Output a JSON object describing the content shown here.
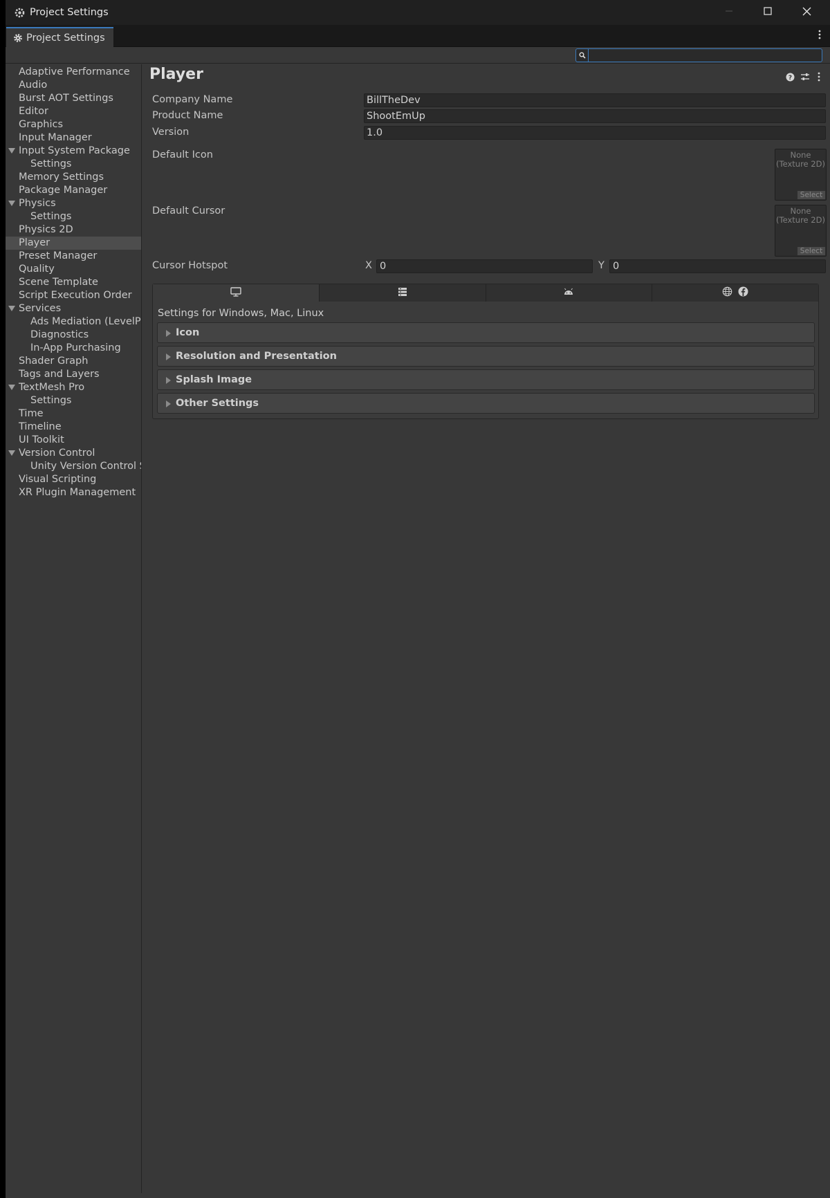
{
  "window": {
    "title": "Project Settings",
    "tab_label": "Project Settings"
  },
  "search": {
    "value": "",
    "placeholder": ""
  },
  "sidebar": {
    "items": [
      {
        "label": "Adaptive Performance",
        "indent": 1
      },
      {
        "label": "Audio",
        "indent": 1
      },
      {
        "label": "Burst AOT Settings",
        "indent": 1
      },
      {
        "label": "Editor",
        "indent": 1
      },
      {
        "label": "Graphics",
        "indent": 1
      },
      {
        "label": "Input Manager",
        "indent": 1
      },
      {
        "label": "Input System Package",
        "indent": 1,
        "expanded": true
      },
      {
        "label": "Settings",
        "indent": 2
      },
      {
        "label": "Memory Settings",
        "indent": 1
      },
      {
        "label": "Package Manager",
        "indent": 1
      },
      {
        "label": "Physics",
        "indent": 1,
        "expanded": true
      },
      {
        "label": "Settings",
        "indent": 2
      },
      {
        "label": "Physics 2D",
        "indent": 1
      },
      {
        "label": "Player",
        "indent": 1,
        "selected": true
      },
      {
        "label": "Preset Manager",
        "indent": 1
      },
      {
        "label": "Quality",
        "indent": 1
      },
      {
        "label": "Scene Template",
        "indent": 1
      },
      {
        "label": "Script Execution Order",
        "indent": 1
      },
      {
        "label": "Services",
        "indent": 1,
        "expanded": true
      },
      {
        "label": "Ads Mediation (LevelPlay)",
        "indent": 2
      },
      {
        "label": "Diagnostics",
        "indent": 2
      },
      {
        "label": "In-App Purchasing",
        "indent": 2
      },
      {
        "label": "Shader Graph",
        "indent": 1
      },
      {
        "label": "Tags and Layers",
        "indent": 1
      },
      {
        "label": "TextMesh Pro",
        "indent": 1,
        "expanded": true
      },
      {
        "label": "Settings",
        "indent": 2
      },
      {
        "label": "Time",
        "indent": 1
      },
      {
        "label": "Timeline",
        "indent": 1
      },
      {
        "label": "UI Toolkit",
        "indent": 1
      },
      {
        "label": "Version Control",
        "indent": 1,
        "expanded": true
      },
      {
        "label": "Unity Version Control Settings",
        "indent": 2
      },
      {
        "label": "Visual Scripting",
        "indent": 1
      },
      {
        "label": "XR Plugin Management",
        "indent": 1
      }
    ]
  },
  "main": {
    "title": "Player",
    "company_name_label": "Company Name",
    "company_name_value": "BillTheDev",
    "product_name_label": "Product Name",
    "product_name_value": "ShootEmUp",
    "version_label": "Version",
    "version_value": "1.0",
    "default_icon_label": "Default Icon",
    "default_cursor_label": "Default Cursor",
    "texture_none_line1": "None",
    "texture_none_line2": "(Texture 2D)",
    "select_label": "Select",
    "cursor_hotspot_label": "Cursor Hotspot",
    "hotspot_x_label": "X",
    "hotspot_x_value": "0",
    "hotspot_y_label": "Y",
    "hotspot_y_value": "0",
    "platform_tabs": [
      "monitor-icon",
      "server-icon",
      "android-icon",
      "web-facebook-icons"
    ],
    "settings_for": "Settings for Windows, Mac, Linux",
    "sections": [
      "Icon",
      "Resolution and Presentation",
      "Splash Image",
      "Other Settings"
    ]
  },
  "colors": {
    "accent": "#3a79bb",
    "background": "#383838",
    "selected": "#4d4d4d"
  }
}
